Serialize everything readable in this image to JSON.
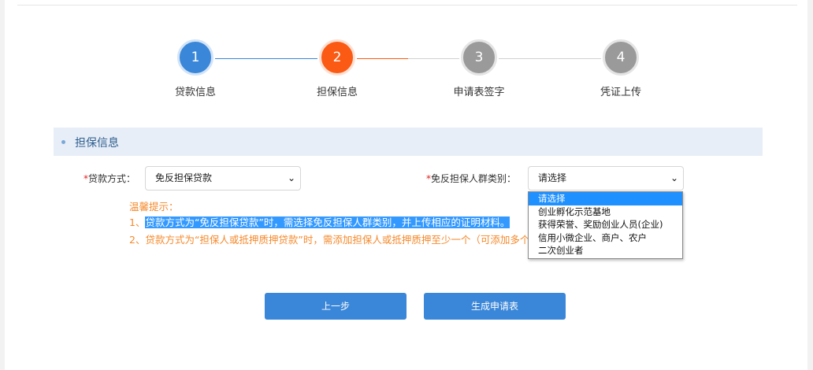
{
  "steps": [
    {
      "number": "1",
      "label": "贷款信息",
      "state": "done"
    },
    {
      "number": "2",
      "label": "担保信息",
      "state": "active"
    },
    {
      "number": "3",
      "label": "申请表签字",
      "state": "todo"
    },
    {
      "number": "4",
      "label": "凭证上传",
      "state": "todo"
    }
  ],
  "colors": {
    "done": "#3a86d8",
    "active": "#fa5a14",
    "todo": "#9a9a9a"
  },
  "section": {
    "title": "担保信息"
  },
  "form": {
    "loan_method": {
      "required_mark": "*",
      "label": "贷款方式：",
      "value": "免反担保贷款"
    },
    "guarantee_group": {
      "required_mark": "*",
      "label": "免反担保人群类别：",
      "value": "请选择"
    }
  },
  "dropdown": {
    "options": [
      "请选择",
      "创业孵化示范基地",
      "获得荣誉、奖励创业人员(企业)",
      "信用小微企业、商户、农户",
      "二次创业者"
    ],
    "selected_index": 0
  },
  "tips": {
    "title": "温馨提示：",
    "line1_prefix": "1、",
    "line1_highlight": "贷款方式为“免反担保贷款”时，需选择免反担保人群类别，并上传相应的证明材料。",
    "line2": "2、贷款方式为“担保人或抵押质押贷款”时，需添加担保人或抵押质押至少一个（可添加多个"
  },
  "buttons": {
    "prev": "上一步",
    "generate": "生成申请表"
  }
}
